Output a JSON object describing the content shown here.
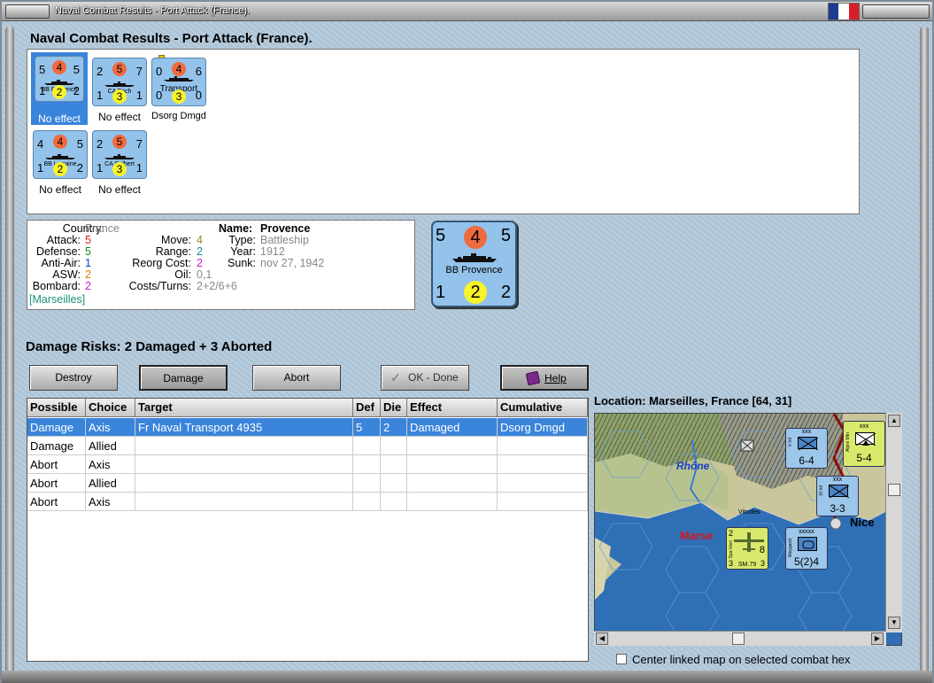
{
  "window": {
    "title": "Naval Combat Results - Port Attack (France)."
  },
  "heading": "Naval Combat Results - Port Attack (France).",
  "units": [
    {
      "name": "BB Provence",
      "tl": "5",
      "top": "4",
      "tr": "5",
      "bl": "1",
      "bottom": "2",
      "br": "2",
      "result": "No effect"
    },
    {
      "name": "CA Foch",
      "tl": "2",
      "top": "5",
      "tr": "7",
      "bl": "1",
      "bottom": "3",
      "br": "1",
      "result": "No effect"
    },
    {
      "name": "Transport",
      "tl": "0",
      "top": "4",
      "tr": "6",
      "bl": "0",
      "bottom": "3",
      "br": "0",
      "result": "Dsorg Dmgd"
    },
    {
      "name": "BB Lorraine",
      "tl": "4",
      "top": "4",
      "tr": "5",
      "bl": "1",
      "bottom": "2",
      "br": "2",
      "result": "No effect"
    },
    {
      "name": "CA Colbert",
      "tl": "2",
      "top": "5",
      "tr": "7",
      "bl": "1",
      "bottom": "3",
      "br": "1",
      "result": "No effect"
    }
  ],
  "info": {
    "labels": {
      "country": "Country:",
      "attack": "Attack:",
      "defense": "Defense:",
      "antiair": "Anti-Air:",
      "asw": "ASW:",
      "bombard": "Bombard:",
      "move": "Move:",
      "range": "Range:",
      "reorg": "Reorg Cost:",
      "oil": "Oil:",
      "costs": "Costs/Turns:",
      "name": "Name:",
      "type": "Type:",
      "year": "Year:",
      "sunk": "Sunk:"
    },
    "country": "France",
    "attack": "5",
    "defense": "5",
    "antiair": "1",
    "asw": "2",
    "bombard": "2",
    "location": "[Marseilles]",
    "move": "4",
    "range": "2",
    "reorg": "2",
    "oil": "0,1",
    "costs": "2+2/6+6",
    "name": "Provence",
    "type": "Battleship",
    "year": "1912",
    "sunk": "nov 27, 1942"
  },
  "big_counter": {
    "tl": "5",
    "top": "4",
    "tr": "5",
    "name": "BB Provence",
    "bl": "1",
    "bottom": "2",
    "br": "2"
  },
  "damage_risks": "Damage Risks: 2 Damaged + 3 Aborted",
  "buttons": {
    "destroy": "Destroy",
    "damage": "Damage",
    "abort": "Abort",
    "ok": "OK - Done",
    "help": "Help"
  },
  "table": {
    "headers": [
      "Possible",
      "Choice",
      "Target",
      "Def",
      "Die",
      "Effect",
      "Cumulative"
    ],
    "rows": [
      [
        "Damage",
        "Axis",
        "Fr Naval Transport 4935",
        "5",
        "2",
        "Damaged",
        "Dsorg Dmgd"
      ],
      [
        "Damage",
        "Allied",
        "",
        "",
        "",
        "",
        ""
      ],
      [
        "Abort",
        "Axis",
        "",
        "",
        "",
        "",
        ""
      ],
      [
        "Abort",
        "Allied",
        "",
        "",
        "",
        "",
        ""
      ],
      [
        "Abort",
        "Axis",
        "",
        "",
        "",
        "",
        ""
      ]
    ]
  },
  "location": "Location:  Marseilles, France [64, 31]",
  "map": {
    "labels": {
      "rhone": "Rhône",
      "marseille": "Marse",
      "nice": "Nice",
      "vitrolles": "Vitrolles"
    },
    "units": [
      {
        "name": "xxx",
        "value": "6-4",
        "side": "V Inf"
      },
      {
        "name": "xxx",
        "value": "5-4",
        "side": "Alpini Mtn"
      },
      {
        "name": "xxx",
        "value": "3-3",
        "side": "XI Inf"
      },
      {
        "name": "xxxxx",
        "value": "5(2)4",
        "side": "Weygand"
      },
      {
        "name": "SM.79",
        "value": "8",
        "top": "2",
        "bl": "3",
        "br": "3",
        "side": "Spa-Vieri"
      }
    ]
  },
  "center_map_label": "Center linked map on selected combat hex"
}
